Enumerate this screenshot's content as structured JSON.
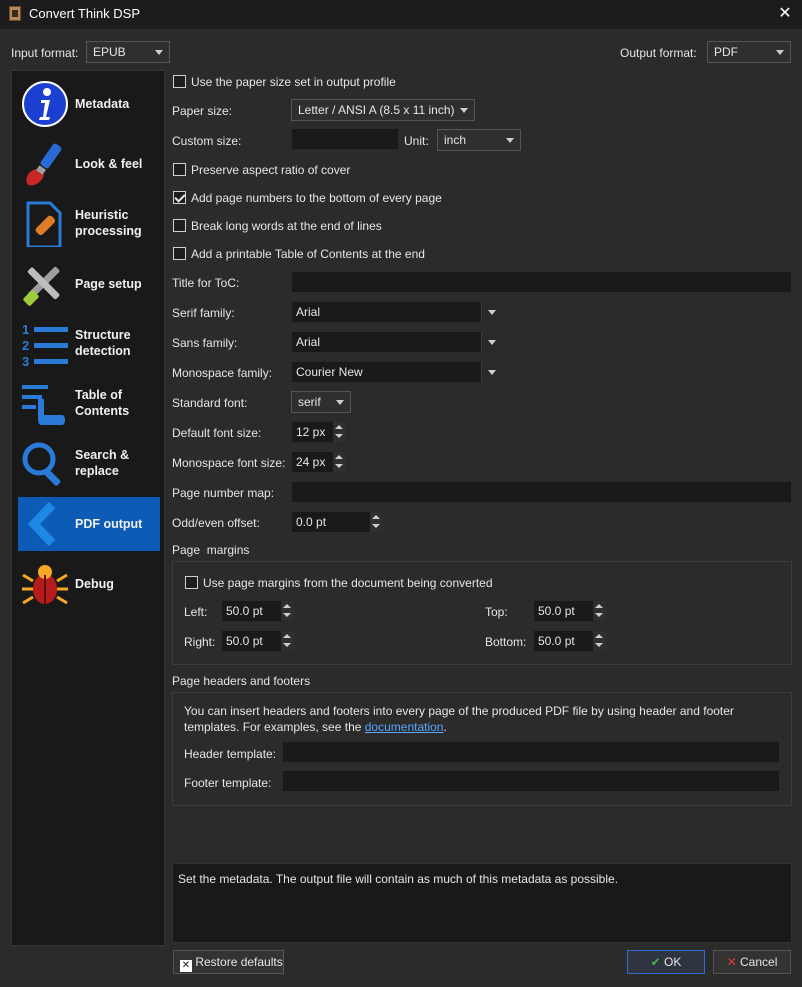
{
  "window": {
    "title": "Convert Think DSP"
  },
  "top": {
    "input_format_label": "Input format:",
    "input_format_value": "EPUB",
    "output_format_label": "Output format:",
    "output_format_value": "PDF"
  },
  "sidebar": {
    "items": [
      {
        "label": "Metadata",
        "icon": "info-icon"
      },
      {
        "label": "Look & feel",
        "icon": "brush-icon"
      },
      {
        "label": "Heuristic\nprocessing",
        "icon": "document-bandage-icon"
      },
      {
        "label": "Page setup",
        "icon": "tools-icon"
      },
      {
        "label": "Structure\ndetection",
        "icon": "numbered-list-icon"
      },
      {
        "label": "Table of\nContents",
        "icon": "toc-icon"
      },
      {
        "label": "Search &\nreplace",
        "icon": "magnifier-icon"
      },
      {
        "label": "PDF output",
        "icon": "chevron-left-icon",
        "active": true
      },
      {
        "label": "Debug",
        "icon": "bug-icon"
      }
    ]
  },
  "form": {
    "use_paper_size": {
      "label": "Use the paper size set in output profile",
      "checked": false
    },
    "paper_size": {
      "label": "Paper size:",
      "value": "Letter / ANSI A (8.5 x 11 inch)"
    },
    "custom_size": {
      "label": "Custom size:",
      "value": "",
      "unit_label": "Unit:",
      "unit_value": "inch"
    },
    "preserve_aspect": {
      "label": "Preserve aspect ratio of cover",
      "checked": false
    },
    "page_numbers": {
      "label": "Add page numbers to the bottom of every page",
      "checked": true
    },
    "break_words": {
      "label": "Break long words at the end of lines",
      "checked": false
    },
    "printable_toc": {
      "label": "Add a printable Table of Contents at the end",
      "checked": false
    },
    "toc_title": {
      "label": "Title for ToC:",
      "value": ""
    },
    "serif_family": {
      "label": "Serif family:",
      "value": "Arial"
    },
    "sans_family": {
      "label": "Sans family:",
      "value": "Arial"
    },
    "mono_family": {
      "label": "Monospace family:",
      "value": "Courier New"
    },
    "standard_font": {
      "label": "Standard font:",
      "value": "serif"
    },
    "default_font_size": {
      "label": "Default font size:",
      "value": "12 px"
    },
    "mono_font_size": {
      "label": "Monospace font size:",
      "value": "24 px"
    },
    "page_number_map": {
      "label": "Page number map:",
      "value": ""
    },
    "odd_even_offset": {
      "label": "Odd/even offset:",
      "value": "0.0 pt"
    }
  },
  "margins": {
    "title": "Page  margins",
    "use_doc_margins": {
      "label": "Use page margins from the document being converted",
      "checked": false
    },
    "left": {
      "label": "Left:",
      "value": "50.0 pt"
    },
    "top": {
      "label": "Top:",
      "value": "50.0 pt"
    },
    "right": {
      "label": "Right:",
      "value": "50.0 pt"
    },
    "bottom": {
      "label": "Bottom:",
      "value": "50.0 pt"
    }
  },
  "headers_footers": {
    "title": "Page headers and footers",
    "info_line1": "You can insert headers and footers into every page of the produced PDF file by using header and footer",
    "info_line2_prefix": "templates. For examples, see the ",
    "info_link": "documentation",
    "info_suffix": ".",
    "header_label": "Header template:",
    "header_value": "",
    "footer_label": "Footer template:",
    "footer_value": ""
  },
  "description": "Set the metadata. The output file will contain as much of this metadata as possible.",
  "buttons": {
    "restore": "Restore defaults",
    "ok": "OK",
    "cancel": "Cancel"
  },
  "colors": {
    "accent": "#0c5bb5",
    "background": "#2b2b2b",
    "field": "#191919",
    "link": "#58a6ff"
  }
}
